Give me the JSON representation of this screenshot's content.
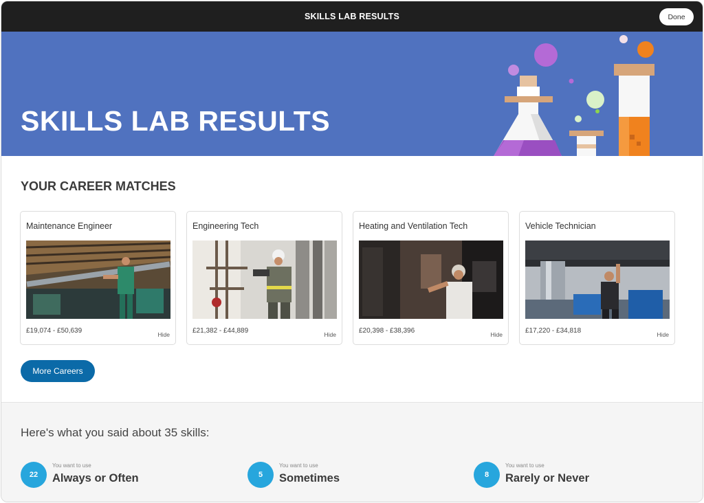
{
  "topbar": {
    "title": "SKILLS LAB RESULTS",
    "done_label": "Done"
  },
  "hero": {
    "title": "SKILLS LAB RESULTS"
  },
  "matches": {
    "heading": "YOUR CAREER MATCHES",
    "cards": [
      {
        "title": "Maintenance Engineer",
        "salary": "£19,074 - £50,639",
        "hide_label": "Hide"
      },
      {
        "title": "Engineering Tech",
        "salary": "£21,382 - £44,889",
        "hide_label": "Hide"
      },
      {
        "title": "Heating and Ventilation Tech",
        "salary": "£20,398 - £38,396",
        "hide_label": "Hide"
      },
      {
        "title": "Vehicle Technician",
        "salary": "£17,220 - £34,818",
        "hide_label": "Hide"
      }
    ],
    "more_label": "More Careers"
  },
  "summary": {
    "heading": "Here's what you said about 35 skills:",
    "stats": [
      {
        "count": "22",
        "caption": "You want to use",
        "label": "Always or Often"
      },
      {
        "count": "5",
        "caption": "You want to use",
        "label": "Sometimes"
      },
      {
        "count": "8",
        "caption": "You want to use",
        "label": "Rarely or Never"
      }
    ]
  },
  "colors": {
    "topbar": "#1f1f1f",
    "hero": "#5072bf",
    "button": "#0b6aa8",
    "stat_circle": "#27a6dd"
  }
}
